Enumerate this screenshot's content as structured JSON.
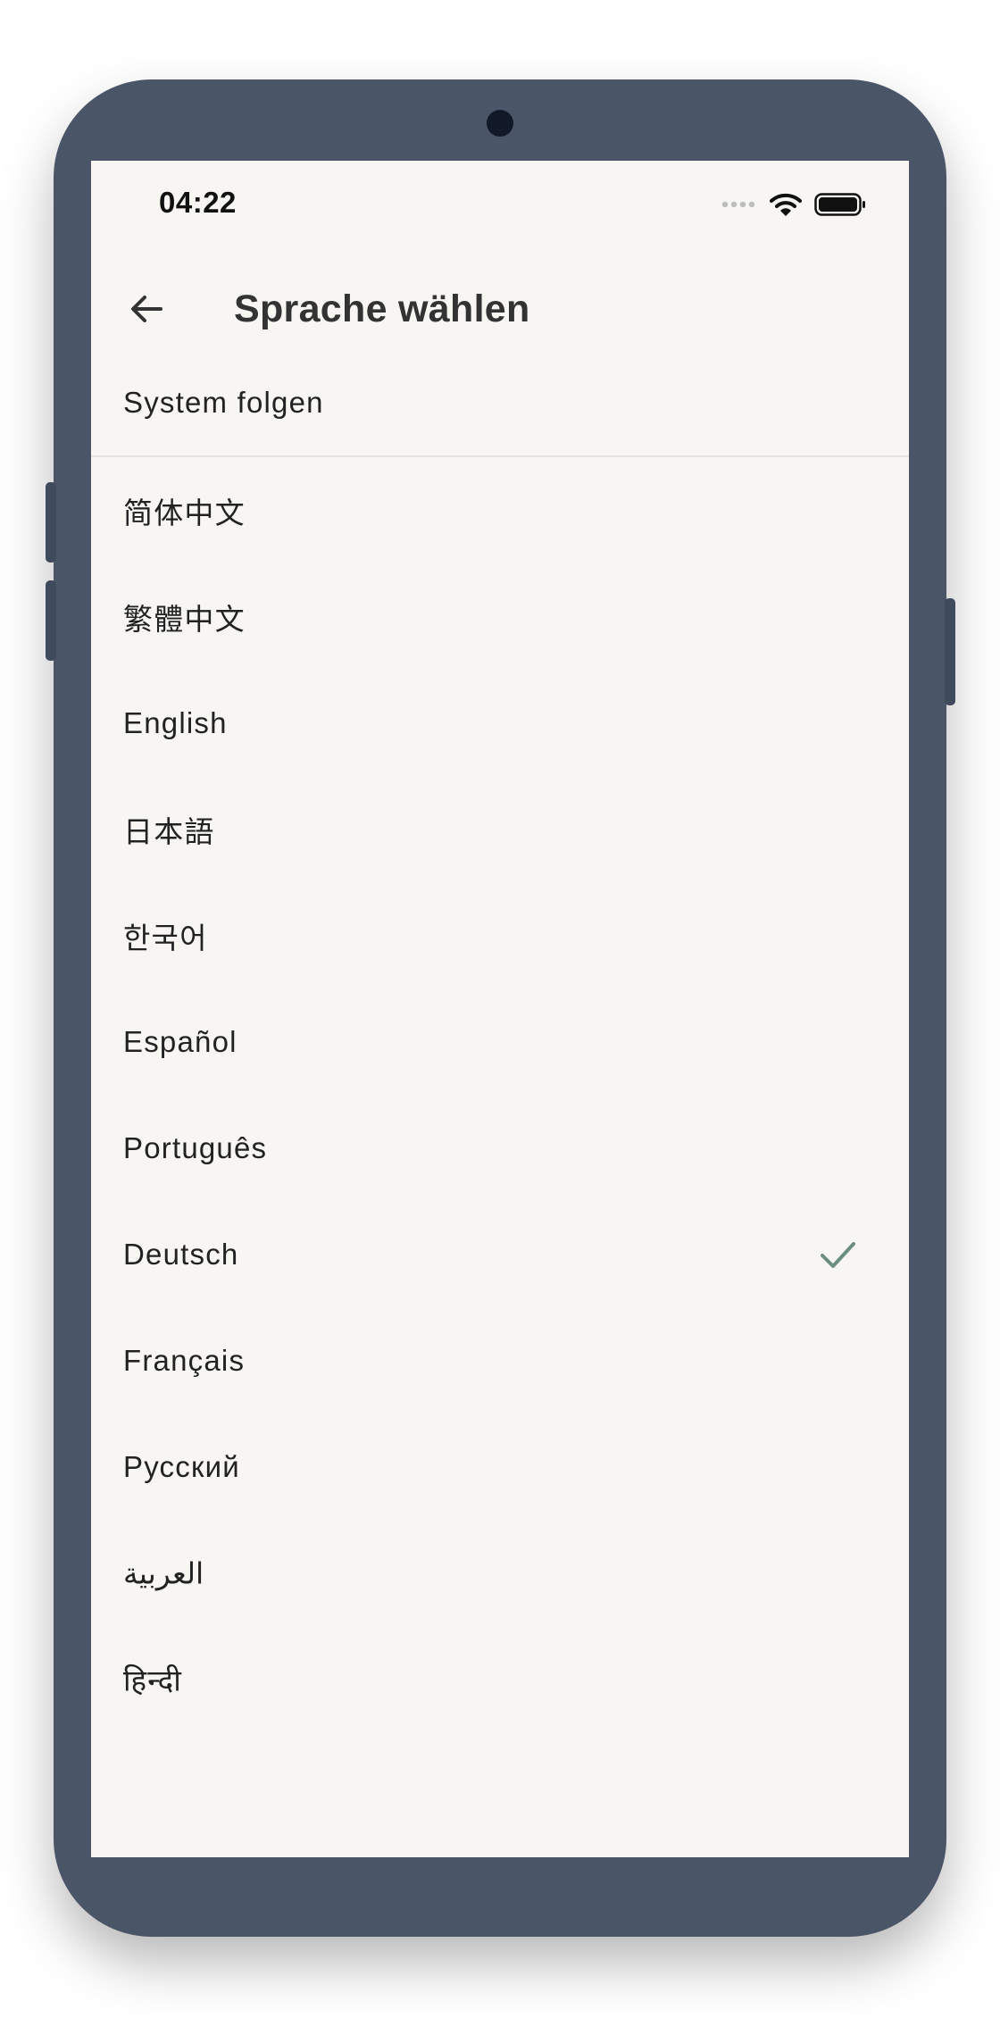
{
  "status_bar": {
    "time": "04:22",
    "icons": [
      "signal-dots-icon",
      "wifi-icon",
      "battery-icon"
    ]
  },
  "app_bar": {
    "back_icon": "arrow-left-icon",
    "title": "Sprache wählen"
  },
  "system_option": {
    "label": "System folgen"
  },
  "languages": [
    {
      "label": "简体中文",
      "selected": false
    },
    {
      "label": "繁體中文",
      "selected": false
    },
    {
      "label": "English",
      "selected": false
    },
    {
      "label": "日本語",
      "selected": false
    },
    {
      "label": "한국어",
      "selected": false
    },
    {
      "label": "Español",
      "selected": false
    },
    {
      "label": "Português",
      "selected": false
    },
    {
      "label": "Deutsch",
      "selected": true
    },
    {
      "label": "Français",
      "selected": false
    },
    {
      "label": "Русский",
      "selected": false
    },
    {
      "label": "العربية",
      "selected": false
    },
    {
      "label": "हिन्दी",
      "selected": false
    }
  ],
  "colors": {
    "frame": "#4a5568",
    "screen_bg": "#f7f6f2",
    "check": "#6b8f7f"
  }
}
